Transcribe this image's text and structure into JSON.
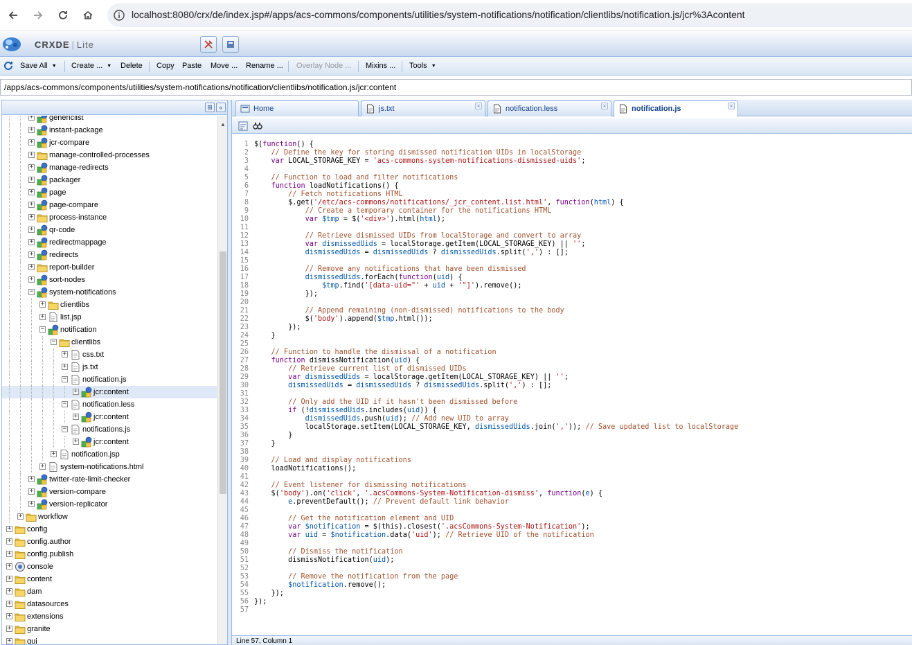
{
  "browser": {
    "url": "localhost:8080/crx/de/index.jsp#/apps/acs-commons/components/utilities/system-notifications/notification/clientlibs/notification.js/jcr%3Acontent"
  },
  "app": {
    "title_main": "CRXDE",
    "title_sep": "|",
    "title_lite": "Lite"
  },
  "toolbar": {
    "save_all": "Save All",
    "create": "Create ...",
    "delete": "Delete",
    "copy": "Copy",
    "paste": "Paste",
    "move": "Move ...",
    "rename": "Rename ...",
    "overlay": "Overlay Node ...",
    "mixins": "Mixins ...",
    "tools": "Tools"
  },
  "path": "/apps/acs-commons/components/utilities/system-notifications/notification/clientlibs/notification.js/jcr:content",
  "tree": [
    {
      "label": "genericlist",
      "depth": 5,
      "type": "component",
      "exp": "+",
      "partial": true
    },
    {
      "label": "instant-package",
      "depth": 5,
      "type": "component",
      "exp": "+"
    },
    {
      "label": "jcr-compare",
      "depth": 5,
      "type": "component",
      "exp": "+"
    },
    {
      "label": "manage-controlled-processes",
      "depth": 5,
      "type": "folder",
      "exp": "+"
    },
    {
      "label": "manage-redirects",
      "depth": 5,
      "type": "component",
      "exp": "+"
    },
    {
      "label": "packager",
      "depth": 5,
      "type": "component",
      "exp": "+"
    },
    {
      "label": "page",
      "depth": 5,
      "type": "component",
      "exp": "+"
    },
    {
      "label": "page-compare",
      "depth": 5,
      "type": "component",
      "exp": "+"
    },
    {
      "label": "process-instance",
      "depth": 5,
      "type": "folder",
      "exp": "+"
    },
    {
      "label": "qr-code",
      "depth": 5,
      "type": "component",
      "exp": "+"
    },
    {
      "label": "redirectmappage",
      "depth": 5,
      "type": "component",
      "exp": "+"
    },
    {
      "label": "redirects",
      "depth": 5,
      "type": "component",
      "exp": "+"
    },
    {
      "label": "report-builder",
      "depth": 5,
      "type": "folder",
      "exp": "+"
    },
    {
      "label": "sort-nodes",
      "depth": 5,
      "type": "component",
      "exp": "+"
    },
    {
      "label": "system-notifications",
      "depth": 5,
      "type": "component",
      "exp": "-"
    },
    {
      "label": "clientlibs",
      "depth": 6,
      "type": "folder",
      "exp": "+"
    },
    {
      "label": "list.jsp",
      "depth": 6,
      "type": "file",
      "exp": "+"
    },
    {
      "label": "notification",
      "depth": 6,
      "type": "component",
      "exp": "-"
    },
    {
      "label": "clientlibs",
      "depth": 7,
      "type": "folder",
      "exp": "-"
    },
    {
      "label": "css.txt",
      "depth": 8,
      "type": "file",
      "exp": "+"
    },
    {
      "label": "js.txt",
      "depth": 8,
      "type": "file",
      "exp": "+"
    },
    {
      "label": "notification.js",
      "depth": 8,
      "type": "file",
      "exp": "-"
    },
    {
      "label": "jcr:content",
      "depth": 9,
      "type": "component",
      "exp": "+",
      "selected": true
    },
    {
      "label": "notification.less",
      "depth": 8,
      "type": "file",
      "exp": "-"
    },
    {
      "label": "jcr:content",
      "depth": 9,
      "type": "component",
      "exp": "+"
    },
    {
      "label": "notifications.js",
      "depth": 8,
      "type": "file",
      "exp": "-"
    },
    {
      "label": "jcr:content",
      "depth": 9,
      "type": "component",
      "exp": "+"
    },
    {
      "label": "notification.jsp",
      "depth": 7,
      "type": "file",
      "exp": "+"
    },
    {
      "label": "system-notifications.html",
      "depth": 6,
      "type": "file",
      "exp": "+"
    },
    {
      "label": "twitter-rate-limit-checker",
      "depth": 5,
      "type": "component",
      "exp": "+"
    },
    {
      "label": "version-compare",
      "depth": 5,
      "type": "component",
      "exp": "+"
    },
    {
      "label": "version-replicator",
      "depth": 5,
      "type": "component",
      "exp": "+"
    },
    {
      "label": "workflow",
      "depth": 4,
      "type": "folder",
      "exp": "+"
    },
    {
      "label": "config",
      "depth": 3,
      "type": "folder",
      "exp": "+"
    },
    {
      "label": "config.author",
      "depth": 3,
      "type": "folder",
      "exp": "+"
    },
    {
      "label": "config.publish",
      "depth": 3,
      "type": "folder",
      "exp": "+"
    },
    {
      "label": "console",
      "depth": 3,
      "type": "console",
      "exp": "+"
    },
    {
      "label": "content",
      "depth": 3,
      "type": "folder",
      "exp": "+"
    },
    {
      "label": "dam",
      "depth": 3,
      "type": "folder",
      "exp": "+"
    },
    {
      "label": "datasources",
      "depth": 3,
      "type": "folder",
      "exp": "+"
    },
    {
      "label": "extensions",
      "depth": 3,
      "type": "folder",
      "exp": "+"
    },
    {
      "label": "granite",
      "depth": 3,
      "type": "folder",
      "exp": "+"
    },
    {
      "label": "gui",
      "depth": 3,
      "type": "folder",
      "exp": "+"
    }
  ],
  "tabs": [
    {
      "label": "Home",
      "icon": "home-icon",
      "closable": false
    },
    {
      "label": "js.txt",
      "icon": "file-icon",
      "closable": true
    },
    {
      "label": "notification.less",
      "icon": "file-icon",
      "closable": true
    },
    {
      "label": "notification.js",
      "icon": "file-icon",
      "closable": true,
      "active": true
    }
  ],
  "code": [
    "$(function() {",
    "    // Define the key for storing dismissed notification UIDs in localStorage",
    "    var LOCAL_STORAGE_KEY = 'acs-commons-system-notifications-dismissed-uids';",
    "",
    "    // Function to load and filter notifications",
    "    function loadNotifications() {",
    "        // Fetch notifications HTML",
    "        $.get('/etc/acs-commons/notifications/_jcr_content.list.html', function(html) {",
    "            // Create a temporary container for the notifications HTML",
    "            var $tmp = $('<div>').html(html);",
    "",
    "            // Retrieve dismissed UIDs from localStorage and convert to array",
    "            var dismissedUids = localStorage.getItem(LOCAL_STORAGE_KEY) || '';",
    "            dismissedUids = dismissedUids ? dismissedUids.split(',') : [];",
    "",
    "            // Remove any notifications that have been dismissed",
    "            dismissedUids.forEach(function(uid) {",
    "                $tmp.find('[data-uid=\"' + uid + '\"]').remove();",
    "            });",
    "",
    "            // Append remaining (non-dismissed) notifications to the body",
    "            $('body').append($tmp.html());",
    "        });",
    "    }",
    "",
    "    // Function to handle the dismissal of a notification",
    "    function dismissNotification(uid) {",
    "        // Retrieve current list of dismissed UIDs",
    "        var dismissedUids = localStorage.getItem(LOCAL_STORAGE_KEY) || '';",
    "        dismissedUids = dismissedUids ? dismissedUids.split(',') : [];",
    "",
    "        // Only add the UID if it hasn't been dismissed before",
    "        if (!dismissedUids.includes(uid)) {",
    "            dismissedUids.push(uid); // Add new UID to array",
    "            localStorage.setItem(LOCAL_STORAGE_KEY, dismissedUids.join(',')); // Save updated list to localStorage",
    "        }",
    "    }",
    "",
    "    // Load and display notifications",
    "    loadNotifications();",
    "",
    "    // Event listener for dismissing notifications",
    "    $('body').on('click', '.acsCommons-System-Notification-dismiss', function(e) {",
    "        e.preventDefault(); // Prevent default link behavior",
    "",
    "        // Get the notification element and UID",
    "        var $notification = $(this).closest('.acsCommons-System-Notification');",
    "        var uid = $notification.data('uid'); // Retrieve UID of the notification",
    "",
    "        // Dismiss the notification",
    "        dismissNotification(uid);",
    "",
    "        // Remove the notification from the page",
    "        $notification.remove();",
    "    });",
    "});",
    ""
  ],
  "status": "Line 57, Column 1"
}
